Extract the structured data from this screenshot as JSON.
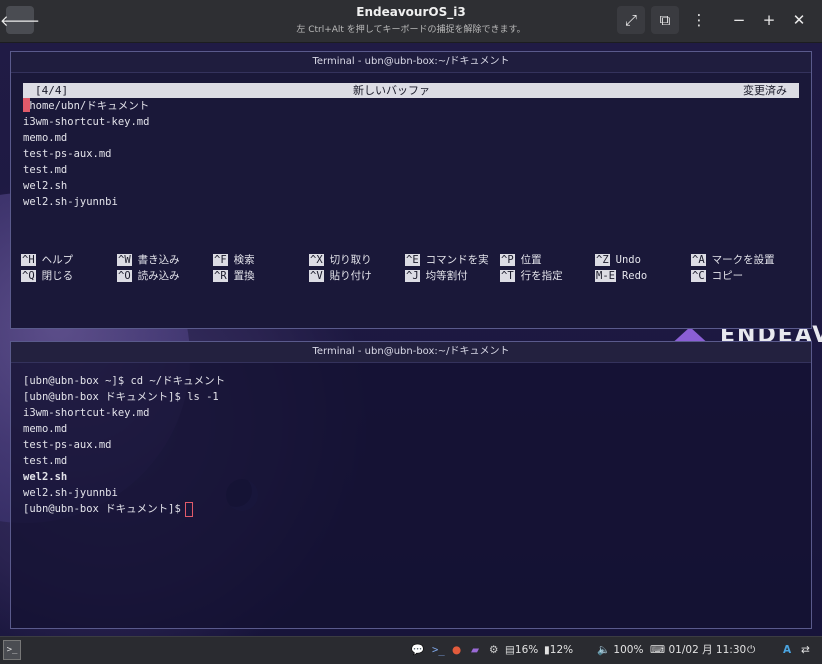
{
  "viewer": {
    "title": "EndeavourOS_i3",
    "subtitle": "左 Ctrl+Alt を押してキーボードの捕捉を解除できます。",
    "back_glyph": "🡐",
    "fullscreen_glyph": "⤢",
    "keyboard_glyph": "⧉",
    "menu_glyph": "⋮",
    "min_glyph": "−",
    "max_glyph": "+",
    "close_glyph": "✕"
  },
  "desktop": {
    "brand_text": "ENDEAVO"
  },
  "nano_window": {
    "title": "Terminal - ubn@ubn-box:~/ドキュメント",
    "header_left": "[4/4]",
    "header_center": "新しいバッファ",
    "header_right": "変更済み",
    "content_lines": [
      "/home/ubn/ドキュメント",
      "i3wm-shortcut-key.md",
      "memo.md",
      "test-ps-aux.md",
      "test.md",
      "wel2.sh",
      "wel2.sh-jyunnbi"
    ],
    "shortcuts_row1": [
      {
        "key": "^H",
        "label": "ヘルプ"
      },
      {
        "key": "^W",
        "label": "書き込み"
      },
      {
        "key": "^F",
        "label": "検索"
      },
      {
        "key": "^X",
        "label": "切り取り"
      },
      {
        "key": "^E",
        "label": "コマンドを実"
      },
      {
        "key": "^P",
        "label": "位置"
      },
      {
        "key": "^Z",
        "label": "Undo"
      },
      {
        "key": "^A",
        "label": "マークを設置"
      }
    ],
    "shortcuts_row2": [
      {
        "key": "^Q",
        "label": "閉じる"
      },
      {
        "key": "^O",
        "label": "読み込み"
      },
      {
        "key": "^R",
        "label": "置換"
      },
      {
        "key": "^V",
        "label": "貼り付け"
      },
      {
        "key": "^J",
        "label": "均等割付"
      },
      {
        "key": "^T",
        "label": "行を指定"
      },
      {
        "key": "M-E",
        "label": "Redo"
      },
      {
        "key": "^C",
        "label": "コピー"
      }
    ]
  },
  "shell_window": {
    "title": "Terminal - ubn@ubn-box:~/ドキュメント",
    "lines": [
      {
        "text": "[ubn@ubn-box ~]$ cd ~/ドキュメント",
        "bold": false
      },
      {
        "text": "[ubn@ubn-box ドキュメント]$ ls -1",
        "bold": false
      },
      {
        "text": "i3wm-shortcut-key.md",
        "bold": false
      },
      {
        "text": "memo.md",
        "bold": false
      },
      {
        "text": "test-ps-aux.md",
        "bold": false
      },
      {
        "text": "test.md",
        "bold": false
      },
      {
        "text": "wel2.sh",
        "bold": true
      },
      {
        "text": "wel2.sh-jyunnbi",
        "bold": false
      }
    ],
    "prompt": "[ubn@ubn-box ドキュメント]$"
  },
  "taskbar": {
    "launcher_glyph": ">_",
    "chat_icon_glyph": "💬",
    "terminal_icon_glyph": ">_",
    "firefox_icon_glyph": "●",
    "folder_icon_glyph": "▰",
    "settings_icon_glyph": "⚙",
    "cpu_label": "16%",
    "mem_label": "12%",
    "volume_label": "100%",
    "datetime": "01/02 月 11:30",
    "power_glyph": "⏻",
    "lang_glyph": "A",
    "network_glyph": "⇄",
    "colors": {
      "chat": "#e0c34c",
      "firefox": "#e25b3c",
      "folder": "#9a6ad6",
      "settings": "#d0d0d0",
      "lang": "#4aa3df"
    }
  }
}
